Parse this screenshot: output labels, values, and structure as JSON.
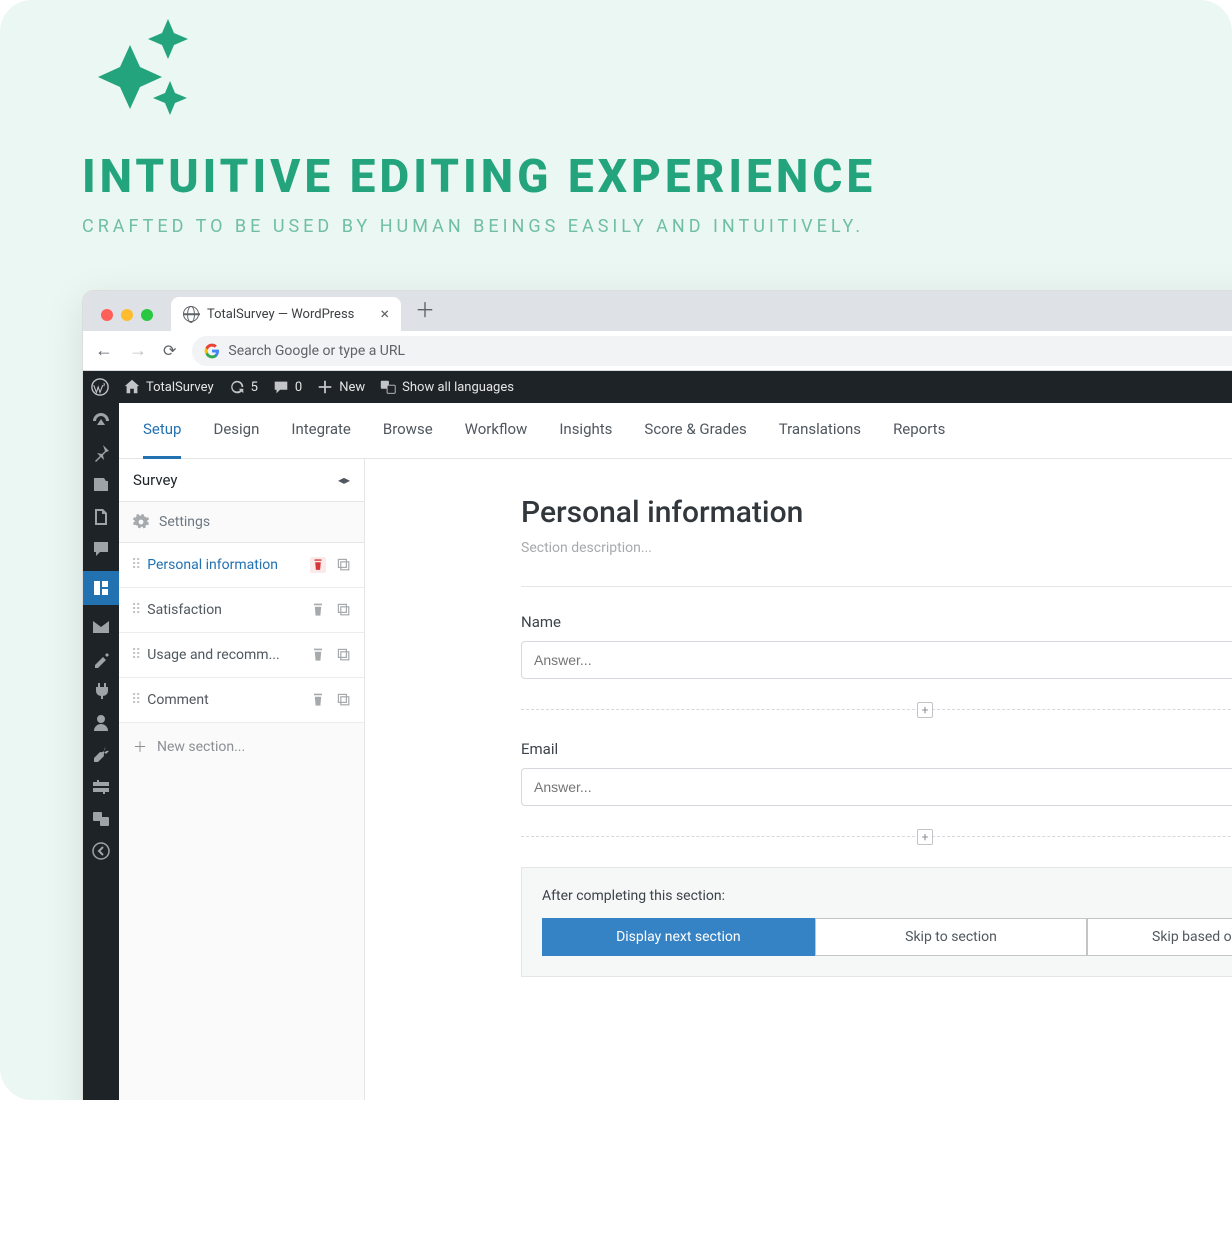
{
  "promo": {
    "heading": "INTUITIVE EDITING EXPERIENCE",
    "sub": "CRAFTED TO BE USED BY HUMAN BEINGS EASILY AND INTUITIVELY."
  },
  "browser": {
    "tab_title": "TotalSurvey — WordPress",
    "url_placeholder": "Search Google or type a URL"
  },
  "adminbar": {
    "site": "TotalSurvey",
    "updates": "5",
    "comments": "0",
    "new": "New",
    "languages": "Show all languages"
  },
  "tabs": [
    "Setup",
    "Design",
    "Integrate",
    "Browse",
    "Workflow",
    "Insights",
    "Score & Grades",
    "Translations",
    "Reports"
  ],
  "panel": {
    "title": "Survey",
    "settings": "Settings",
    "new_section": "New section..."
  },
  "sections": [
    {
      "label": "Personal information",
      "active": true
    },
    {
      "label": "Satisfaction",
      "active": false
    },
    {
      "label": "Usage and recomm...",
      "active": false
    },
    {
      "label": "Comment",
      "active": false
    }
  ],
  "canvas": {
    "title": "Personal information",
    "desc_placeholder": "Section description...",
    "fields": [
      {
        "label": "Name",
        "placeholder": "Answer..."
      },
      {
        "label": "Email",
        "placeholder": "Answer..."
      }
    ],
    "after_label": "After completing this section:",
    "after_options": [
      "Display next section",
      "Skip to section",
      "Skip based on answers"
    ]
  }
}
